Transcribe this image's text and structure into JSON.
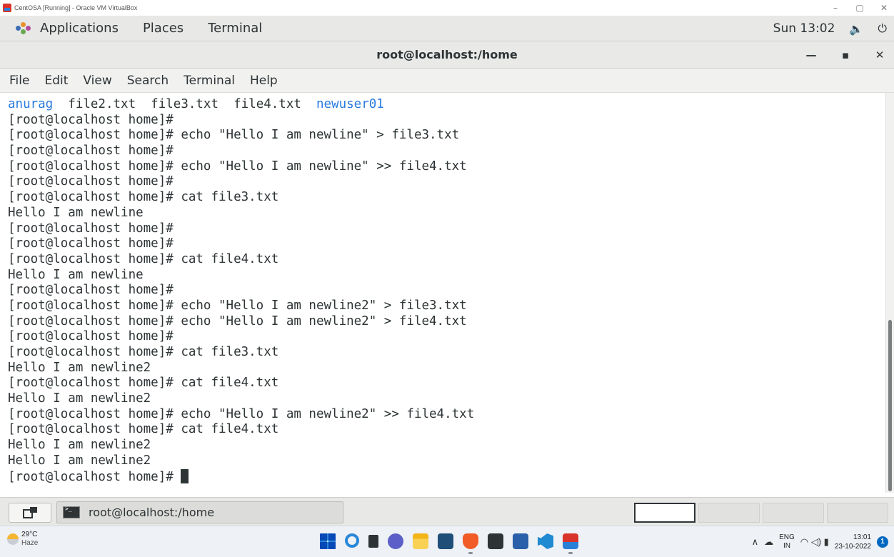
{
  "vbox": {
    "title": "CentOSA [Running] - Oracle VM VirtualBox",
    "minimize": "–",
    "restore": "▢",
    "close": "✕"
  },
  "gnome_panel": {
    "applications": "Applications",
    "places": "Places",
    "terminal": "Terminal",
    "clock": "Sun 13:02",
    "sound_icon": "🔈",
    "power_icon": "⏻"
  },
  "terminal_window": {
    "title": "root@localhost:/home",
    "minimize": "—",
    "maximize": "▪",
    "close": "✕"
  },
  "menu": [
    "File",
    "Edit",
    "View",
    "Search",
    "Terminal",
    "Help"
  ],
  "terminal": {
    "ls": {
      "dir1": "anurag",
      "files": "  file2.txt  file3.txt  file4.txt  ",
      "dir2": "newuser01"
    },
    "lines": [
      "[root@localhost home]#",
      "[root@localhost home]# echo \"Hello I am newline\" > file3.txt",
      "[root@localhost home]#",
      "[root@localhost home]# echo \"Hello I am newline\" >> file4.txt",
      "[root@localhost home]#",
      "[root@localhost home]# cat file3.txt",
      "Hello I am newline",
      "[root@localhost home]#",
      "[root@localhost home]#",
      "[root@localhost home]# cat file4.txt",
      "Hello I am newline",
      "[root@localhost home]#",
      "[root@localhost home]# echo \"Hello I am newline2\" > file3.txt",
      "[root@localhost home]# echo \"Hello I am newline2\" > file4.txt",
      "[root@localhost home]#",
      "[root@localhost home]# cat file3.txt",
      "Hello I am newline2",
      "[root@localhost home]# cat file4.txt",
      "Hello I am newline2",
      "[root@localhost home]# echo \"Hello I am newline2\" >> file4.txt",
      "[root@localhost home]# cat file4.txt",
      "Hello I am newline2",
      "Hello I am newline2"
    ],
    "prompt": "[root@localhost home]# "
  },
  "window_list": {
    "terminal_button": "root@localhost:/home"
  },
  "win_taskbar": {
    "temp": "29°C",
    "weather": "Haze",
    "lang_top": "ENG",
    "lang_bottom": "IN",
    "time": "13:01",
    "date": "23-10-2022",
    "notifications": "1",
    "chevron": "∧",
    "wifi_sound": "◠ ◁) ▮"
  },
  "colors": {
    "ls_dir": "#2a7bde",
    "text": "#2e3436",
    "panel": "#e8e8e7"
  }
}
